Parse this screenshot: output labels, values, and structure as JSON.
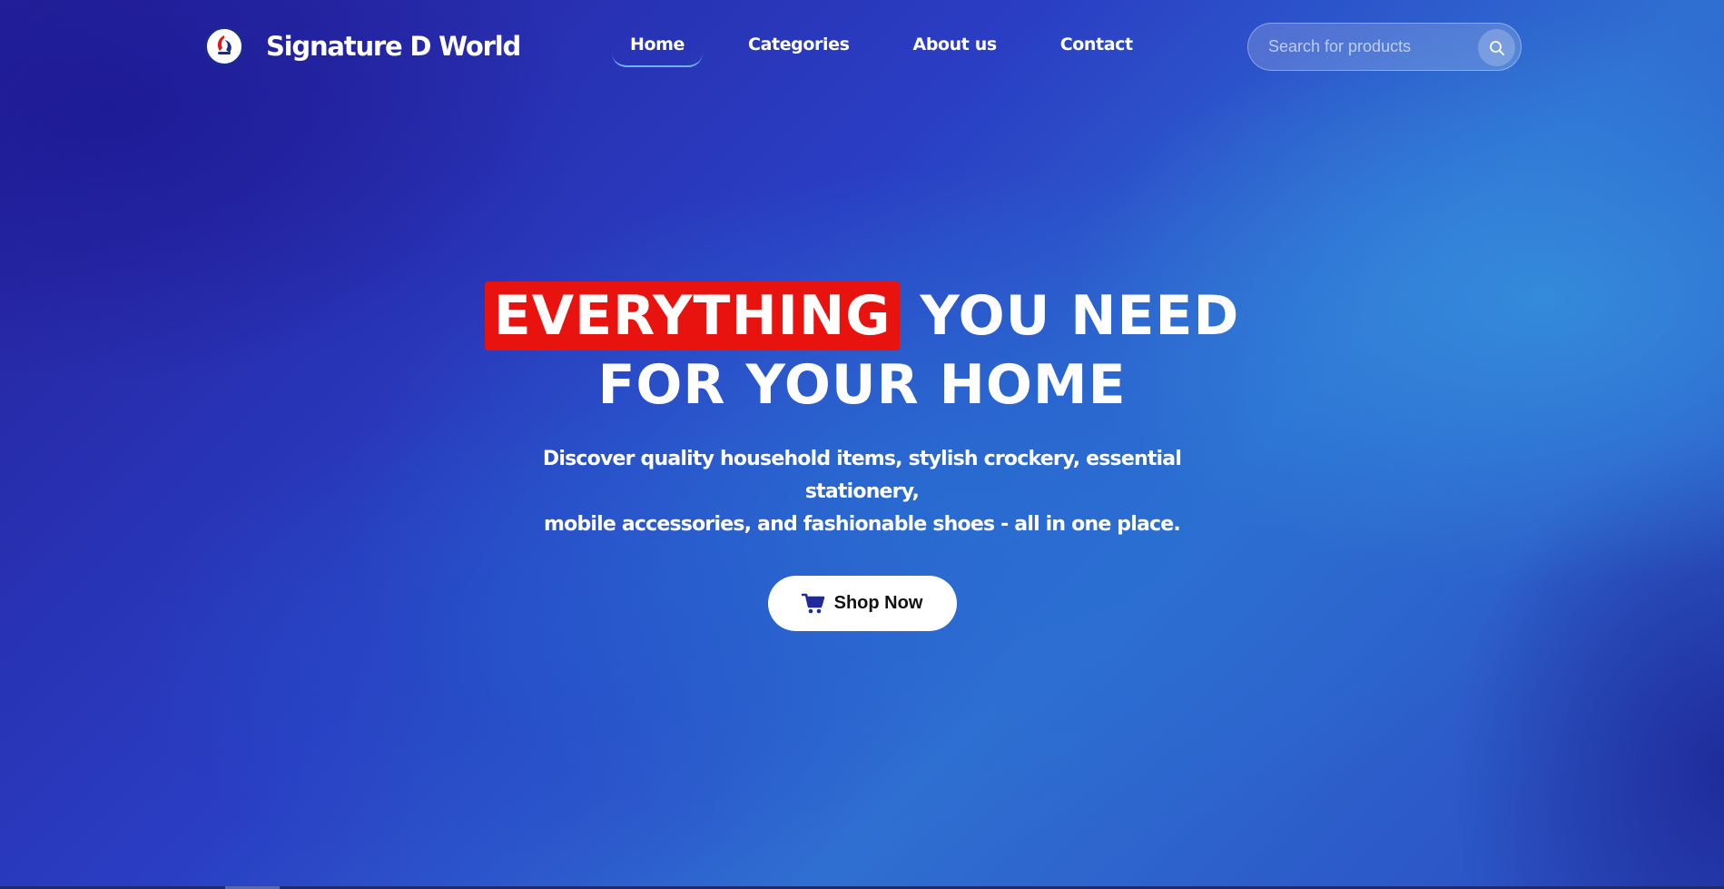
{
  "header": {
    "brand_name": "Signature D World",
    "nav": [
      {
        "label": "Home",
        "active": true
      },
      {
        "label": "Categories",
        "active": false
      },
      {
        "label": "About us",
        "active": false
      },
      {
        "label": "Contact",
        "active": false
      }
    ],
    "search": {
      "placeholder": "Search for products",
      "icon": "search-icon"
    }
  },
  "hero": {
    "title_highlight": "EVERYTHING",
    "title_rest": " YOU NEED",
    "title_line2": "FOR YOUR HOME",
    "subtitle_line1": "Discover quality household items, stylish crockery, essential stationery,",
    "subtitle_line2": "mobile accessories, and fashionable shoes - all in one place.",
    "cta_label": "Shop Now",
    "cta_icon": "cart-icon"
  },
  "colors": {
    "highlight": "#e8120f",
    "cta_icon": "#1e2a9a",
    "background_start": "#25209a",
    "background_end": "#2f6fd2"
  }
}
